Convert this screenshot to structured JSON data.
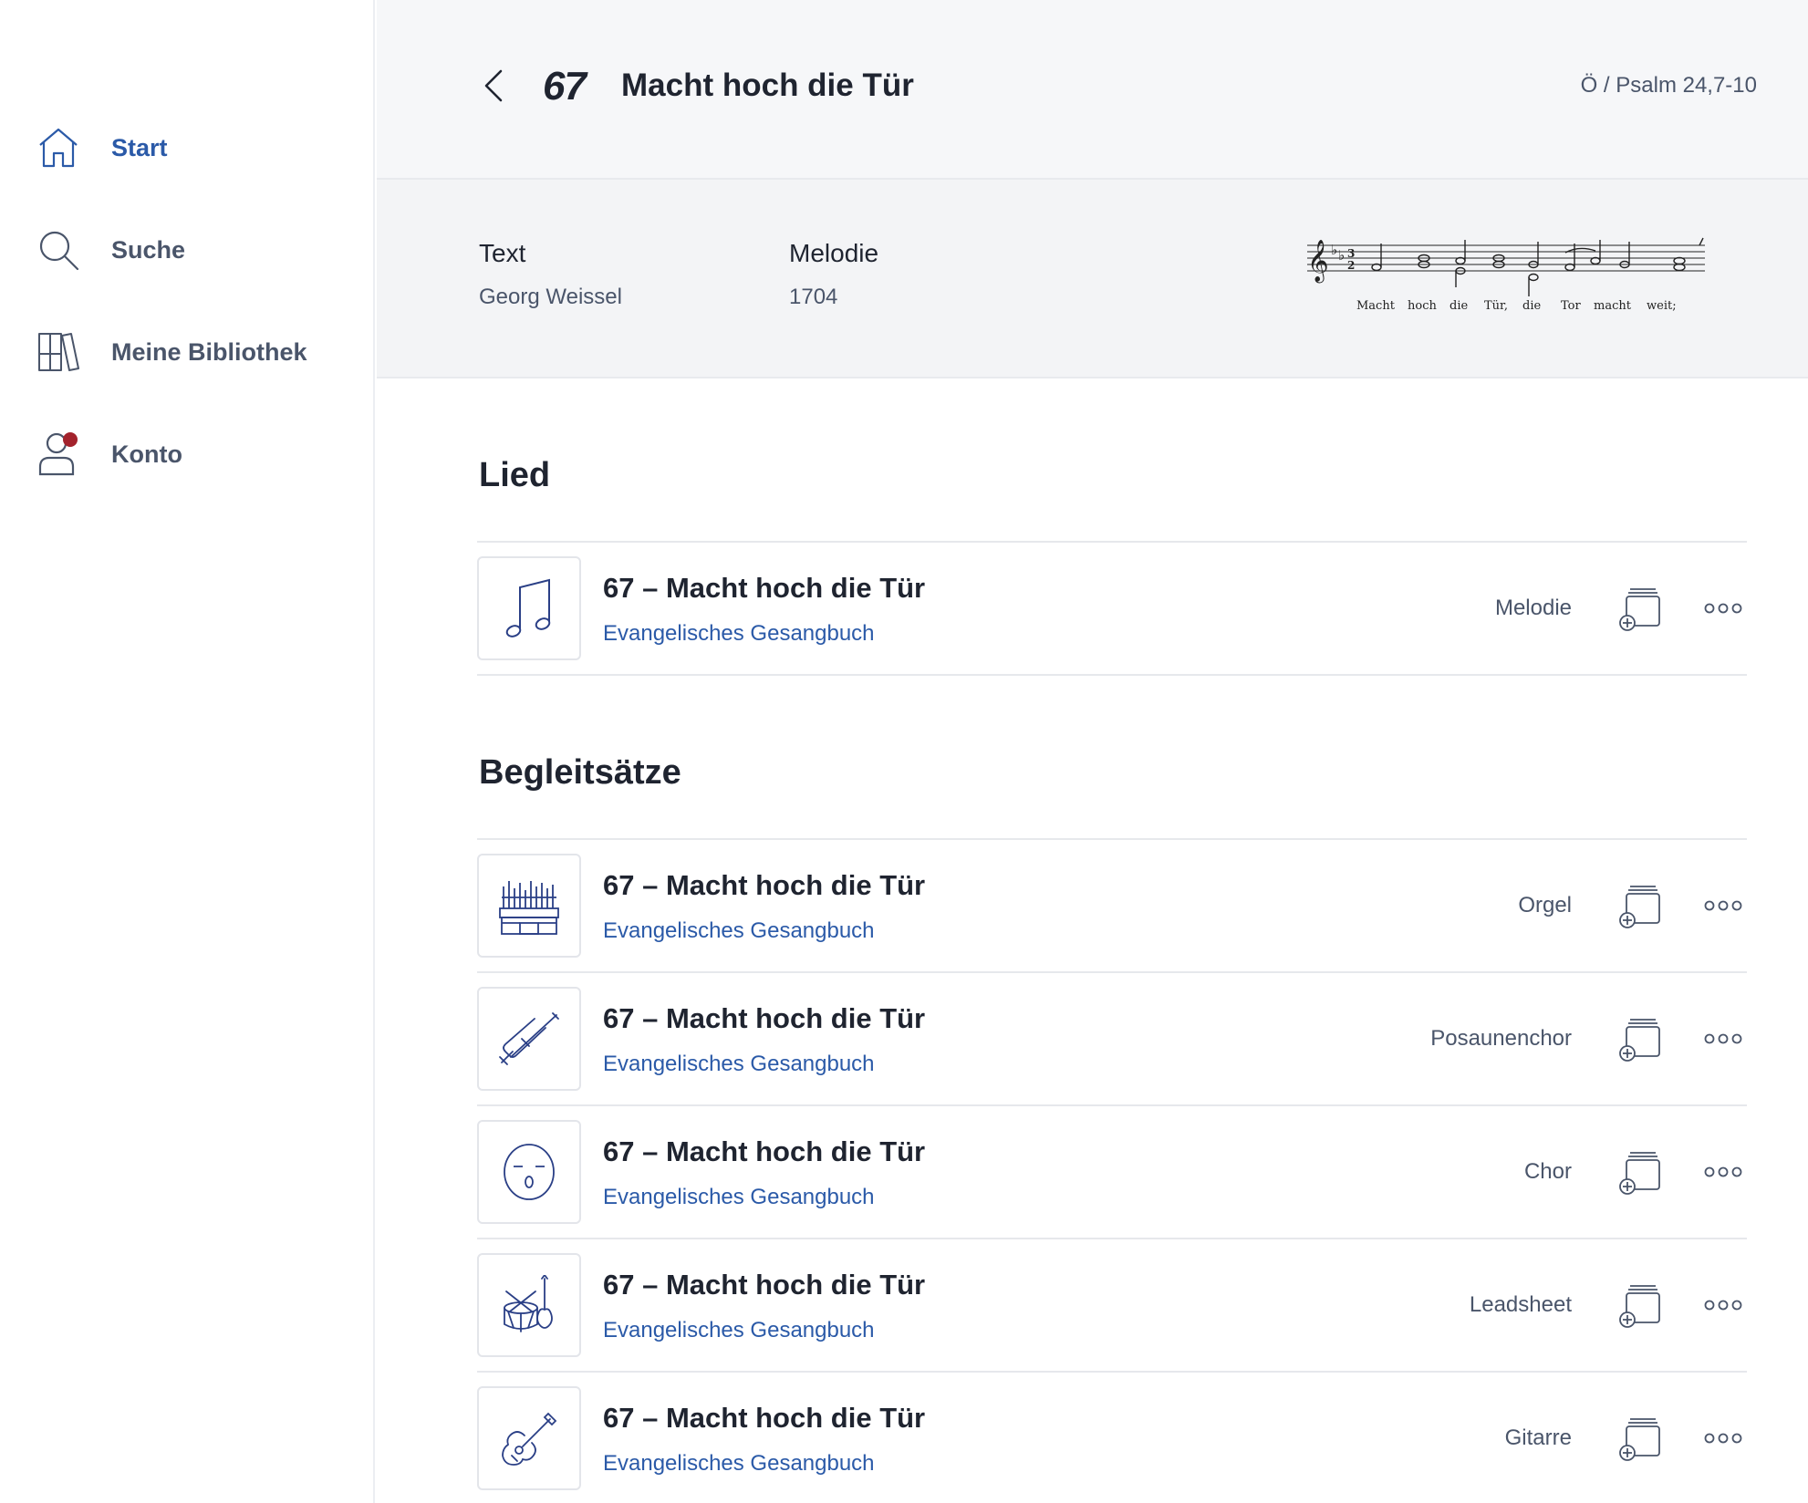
{
  "sidebar": {
    "items": [
      {
        "label": "Start",
        "icon": "home-icon",
        "active": true
      },
      {
        "label": "Suche",
        "icon": "search-icon",
        "active": false
      },
      {
        "label": "Meine Bibliothek",
        "icon": "library-icon",
        "active": false
      },
      {
        "label": "Konto",
        "icon": "account-icon",
        "active": false,
        "badge": true
      }
    ]
  },
  "header": {
    "number": "67",
    "title": "Macht hoch die Tür",
    "reference": "Ö / Psalm 24,7-10"
  },
  "info": {
    "text_label": "Text",
    "text_value": "Georg Weissel",
    "melody_label": "Melodie",
    "melody_value": "1704",
    "notation_lyrics": [
      "Macht",
      "hoch",
      "die",
      "Tür,",
      "die",
      "Tor",
      "macht",
      "weit;"
    ]
  },
  "sections": {
    "lied_title": "Lied",
    "begleit_title": "Begleitsätze"
  },
  "lied": [
    {
      "title": "67 – Macht hoch die Tür",
      "source": "Evangelisches Gesangbuch",
      "type": "Melodie",
      "icon": "music-note-icon"
    }
  ],
  "begleitsaetze": [
    {
      "title": "67 – Macht hoch die Tür",
      "source": "Evangelisches Gesangbuch",
      "type": "Orgel",
      "icon": "organ-icon"
    },
    {
      "title": "67 – Macht hoch die Tür",
      "source": "Evangelisches Gesangbuch",
      "type": "Posaunenchor",
      "icon": "trombone-icon"
    },
    {
      "title": "67 – Macht hoch die Tür",
      "source": "Evangelisches Gesangbuch",
      "type": "Chor",
      "icon": "singing-face-icon"
    },
    {
      "title": "67 – Macht hoch die Tür",
      "source": "Evangelisches Gesangbuch",
      "type": "Leadsheet",
      "icon": "band-instruments-icon"
    },
    {
      "title": "67 – Macht hoch die Tür",
      "source": "Evangelisches Gesangbuch",
      "type": "Gitarre",
      "icon": "guitar-icon"
    }
  ],
  "colors": {
    "accent": "#2b5aa8",
    "icon_navy": "#2a3f86",
    "badge": "#a3222c",
    "muted_text": "#4a556a"
  }
}
